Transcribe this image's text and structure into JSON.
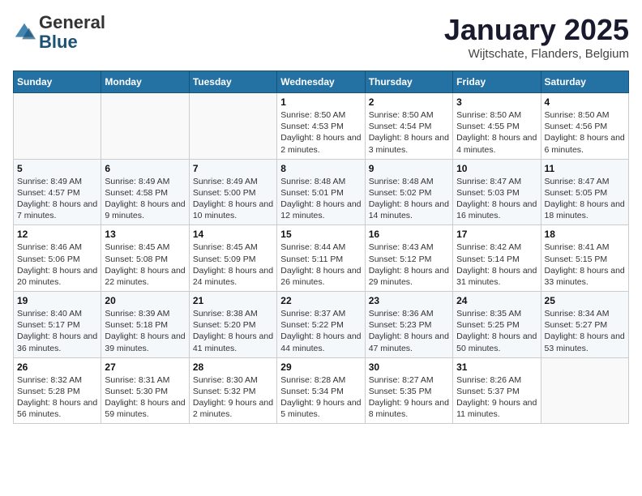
{
  "logo": {
    "general": "General",
    "blue": "Blue"
  },
  "title": "January 2025",
  "subtitle": "Wijtschate, Flanders, Belgium",
  "weekdays": [
    "Sunday",
    "Monday",
    "Tuesday",
    "Wednesday",
    "Thursday",
    "Friday",
    "Saturday"
  ],
  "weeks": [
    [
      {
        "day": "",
        "sunrise": "",
        "sunset": "",
        "daylight": ""
      },
      {
        "day": "",
        "sunrise": "",
        "sunset": "",
        "daylight": ""
      },
      {
        "day": "",
        "sunrise": "",
        "sunset": "",
        "daylight": ""
      },
      {
        "day": "1",
        "sunrise": "Sunrise: 8:50 AM",
        "sunset": "Sunset: 4:53 PM",
        "daylight": "Daylight: 8 hours and 2 minutes."
      },
      {
        "day": "2",
        "sunrise": "Sunrise: 8:50 AM",
        "sunset": "Sunset: 4:54 PM",
        "daylight": "Daylight: 8 hours and 3 minutes."
      },
      {
        "day": "3",
        "sunrise": "Sunrise: 8:50 AM",
        "sunset": "Sunset: 4:55 PM",
        "daylight": "Daylight: 8 hours and 4 minutes."
      },
      {
        "day": "4",
        "sunrise": "Sunrise: 8:50 AM",
        "sunset": "Sunset: 4:56 PM",
        "daylight": "Daylight: 8 hours and 6 minutes."
      }
    ],
    [
      {
        "day": "5",
        "sunrise": "Sunrise: 8:49 AM",
        "sunset": "Sunset: 4:57 PM",
        "daylight": "Daylight: 8 hours and 7 minutes."
      },
      {
        "day": "6",
        "sunrise": "Sunrise: 8:49 AM",
        "sunset": "Sunset: 4:58 PM",
        "daylight": "Daylight: 8 hours and 9 minutes."
      },
      {
        "day": "7",
        "sunrise": "Sunrise: 8:49 AM",
        "sunset": "Sunset: 5:00 PM",
        "daylight": "Daylight: 8 hours and 10 minutes."
      },
      {
        "day": "8",
        "sunrise": "Sunrise: 8:48 AM",
        "sunset": "Sunset: 5:01 PM",
        "daylight": "Daylight: 8 hours and 12 minutes."
      },
      {
        "day": "9",
        "sunrise": "Sunrise: 8:48 AM",
        "sunset": "Sunset: 5:02 PM",
        "daylight": "Daylight: 8 hours and 14 minutes."
      },
      {
        "day": "10",
        "sunrise": "Sunrise: 8:47 AM",
        "sunset": "Sunset: 5:03 PM",
        "daylight": "Daylight: 8 hours and 16 minutes."
      },
      {
        "day": "11",
        "sunrise": "Sunrise: 8:47 AM",
        "sunset": "Sunset: 5:05 PM",
        "daylight": "Daylight: 8 hours and 18 minutes."
      }
    ],
    [
      {
        "day": "12",
        "sunrise": "Sunrise: 8:46 AM",
        "sunset": "Sunset: 5:06 PM",
        "daylight": "Daylight: 8 hours and 20 minutes."
      },
      {
        "day": "13",
        "sunrise": "Sunrise: 8:45 AM",
        "sunset": "Sunset: 5:08 PM",
        "daylight": "Daylight: 8 hours and 22 minutes."
      },
      {
        "day": "14",
        "sunrise": "Sunrise: 8:45 AM",
        "sunset": "Sunset: 5:09 PM",
        "daylight": "Daylight: 8 hours and 24 minutes."
      },
      {
        "day": "15",
        "sunrise": "Sunrise: 8:44 AM",
        "sunset": "Sunset: 5:11 PM",
        "daylight": "Daylight: 8 hours and 26 minutes."
      },
      {
        "day": "16",
        "sunrise": "Sunrise: 8:43 AM",
        "sunset": "Sunset: 5:12 PM",
        "daylight": "Daylight: 8 hours and 29 minutes."
      },
      {
        "day": "17",
        "sunrise": "Sunrise: 8:42 AM",
        "sunset": "Sunset: 5:14 PM",
        "daylight": "Daylight: 8 hours and 31 minutes."
      },
      {
        "day": "18",
        "sunrise": "Sunrise: 8:41 AM",
        "sunset": "Sunset: 5:15 PM",
        "daylight": "Daylight: 8 hours and 33 minutes."
      }
    ],
    [
      {
        "day": "19",
        "sunrise": "Sunrise: 8:40 AM",
        "sunset": "Sunset: 5:17 PM",
        "daylight": "Daylight: 8 hours and 36 minutes."
      },
      {
        "day": "20",
        "sunrise": "Sunrise: 8:39 AM",
        "sunset": "Sunset: 5:18 PM",
        "daylight": "Daylight: 8 hours and 39 minutes."
      },
      {
        "day": "21",
        "sunrise": "Sunrise: 8:38 AM",
        "sunset": "Sunset: 5:20 PM",
        "daylight": "Daylight: 8 hours and 41 minutes."
      },
      {
        "day": "22",
        "sunrise": "Sunrise: 8:37 AM",
        "sunset": "Sunset: 5:22 PM",
        "daylight": "Daylight: 8 hours and 44 minutes."
      },
      {
        "day": "23",
        "sunrise": "Sunrise: 8:36 AM",
        "sunset": "Sunset: 5:23 PM",
        "daylight": "Daylight: 8 hours and 47 minutes."
      },
      {
        "day": "24",
        "sunrise": "Sunrise: 8:35 AM",
        "sunset": "Sunset: 5:25 PM",
        "daylight": "Daylight: 8 hours and 50 minutes."
      },
      {
        "day": "25",
        "sunrise": "Sunrise: 8:34 AM",
        "sunset": "Sunset: 5:27 PM",
        "daylight": "Daylight: 8 hours and 53 minutes."
      }
    ],
    [
      {
        "day": "26",
        "sunrise": "Sunrise: 8:32 AM",
        "sunset": "Sunset: 5:28 PM",
        "daylight": "Daylight: 8 hours and 56 minutes."
      },
      {
        "day": "27",
        "sunrise": "Sunrise: 8:31 AM",
        "sunset": "Sunset: 5:30 PM",
        "daylight": "Daylight: 8 hours and 59 minutes."
      },
      {
        "day": "28",
        "sunrise": "Sunrise: 8:30 AM",
        "sunset": "Sunset: 5:32 PM",
        "daylight": "Daylight: 9 hours and 2 minutes."
      },
      {
        "day": "29",
        "sunrise": "Sunrise: 8:28 AM",
        "sunset": "Sunset: 5:34 PM",
        "daylight": "Daylight: 9 hours and 5 minutes."
      },
      {
        "day": "30",
        "sunrise": "Sunrise: 8:27 AM",
        "sunset": "Sunset: 5:35 PM",
        "daylight": "Daylight: 9 hours and 8 minutes."
      },
      {
        "day": "31",
        "sunrise": "Sunrise: 8:26 AM",
        "sunset": "Sunset: 5:37 PM",
        "daylight": "Daylight: 9 hours and 11 minutes."
      },
      {
        "day": "",
        "sunrise": "",
        "sunset": "",
        "daylight": ""
      }
    ]
  ]
}
